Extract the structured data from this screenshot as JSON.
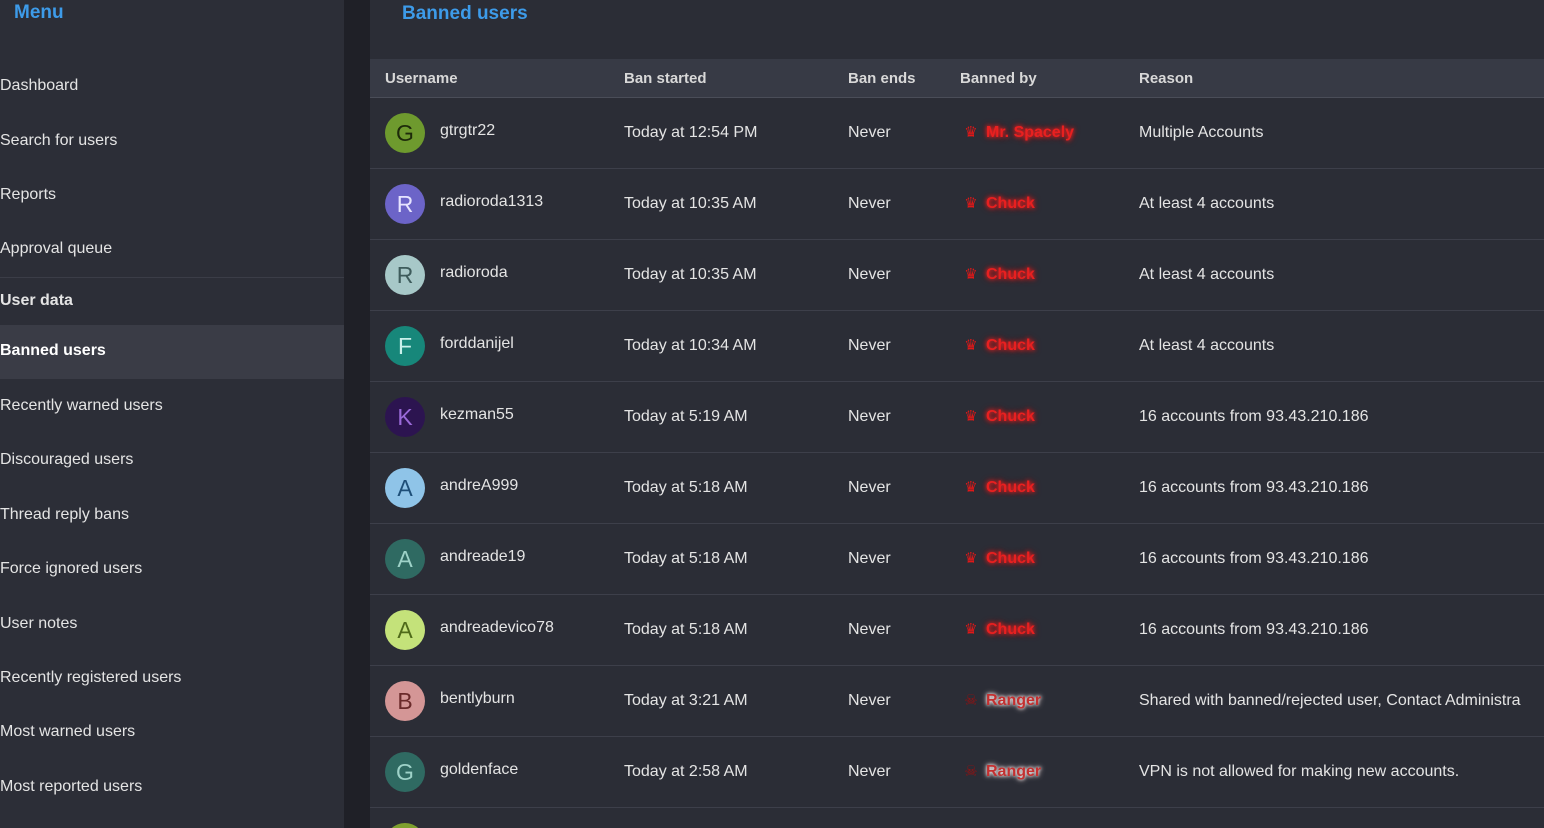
{
  "sidebar": {
    "title": "Menu",
    "items": [
      {
        "label": "Dashboard"
      },
      {
        "label": "Search for users"
      },
      {
        "label": "Reports"
      },
      {
        "label": "Approval queue"
      }
    ],
    "section_label": "User data",
    "active_item": "Banned users",
    "sub_items": [
      {
        "label": "Recently warned users"
      },
      {
        "label": "Discouraged users"
      },
      {
        "label": "Thread reply bans"
      },
      {
        "label": "Force ignored users"
      },
      {
        "label": "User notes"
      },
      {
        "label": "Recently registered users"
      },
      {
        "label": "Most warned users"
      },
      {
        "label": "Most reported users"
      }
    ]
  },
  "main": {
    "title": "Banned users",
    "columns": {
      "username": "Username",
      "ban_started": "Ban started",
      "ban_ends": "Ban ends",
      "banned_by": "Banned by",
      "reason": "Reason"
    },
    "rows": [
      {
        "initial": "G",
        "avatar_bg": "#6e9a2e",
        "avatar_fg": "#1d2a0a",
        "username": "gtrgtr22",
        "ban_started": "Today at 12:54 PM",
        "ban_ends": "Never",
        "banner_icon": "crown-icon",
        "banned_by": "Mr. Spacely",
        "reason": "Multiple Accounts"
      },
      {
        "initial": "R",
        "avatar_bg": "#6c64c8",
        "avatar_fg": "#e6e4ff",
        "username": "radioroda1313",
        "ban_started": "Today at 10:35 AM",
        "ban_ends": "Never",
        "banner_icon": "crown-icon",
        "banned_by": "Chuck",
        "reason": "At least 4 accounts"
      },
      {
        "initial": "R",
        "avatar_bg": "#a7c8c8",
        "avatar_fg": "#3e5c5c",
        "username": "radioroda",
        "ban_started": "Today at 10:35 AM",
        "ban_ends": "Never",
        "banner_icon": "crown-icon",
        "banned_by": "Chuck",
        "reason": "At least 4 accounts"
      },
      {
        "initial": "F",
        "avatar_bg": "#17877a",
        "avatar_fg": "#c8f0ea",
        "username": "forddanijel",
        "ban_started": "Today at 10:34 AM",
        "ban_ends": "Never",
        "banner_icon": "crown-icon",
        "banned_by": "Chuck",
        "reason": "At least 4 accounts"
      },
      {
        "initial": "K",
        "avatar_bg": "#2c1450",
        "avatar_fg": "#9a6ad8",
        "username": "kezman55",
        "ban_started": "Today at 5:19 AM",
        "ban_ends": "Never",
        "banner_icon": "crown-icon",
        "banned_by": "Chuck",
        "reason": "16 accounts from 93.43.210.186"
      },
      {
        "initial": "A",
        "avatar_bg": "#8fc4e8",
        "avatar_fg": "#1e4f78",
        "username": "andreA999",
        "ban_started": "Today at 5:18 AM",
        "ban_ends": "Never",
        "banner_icon": "crown-icon",
        "banned_by": "Chuck",
        "reason": "16 accounts from 93.43.210.186"
      },
      {
        "initial": "A",
        "avatar_bg": "#2f6a62",
        "avatar_fg": "#9ed2c8",
        "username": "andreade19",
        "ban_started": "Today at 5:18 AM",
        "ban_ends": "Never",
        "banner_icon": "crown-icon",
        "banned_by": "Chuck",
        "reason": "16 accounts from 93.43.210.186"
      },
      {
        "initial": "A",
        "avatar_bg": "#c4e27a",
        "avatar_fg": "#4f6a1a",
        "username": "andreadevico78",
        "ban_started": "Today at 5:18 AM",
        "ban_ends": "Never",
        "banner_icon": "crown-icon",
        "banned_by": "Chuck",
        "reason": "16 accounts from 93.43.210.186"
      },
      {
        "initial": "B",
        "avatar_bg": "#d49696",
        "avatar_fg": "#6a2a2a",
        "username": "bentlyburn",
        "ban_started": "Today at 3:21 AM",
        "ban_ends": "Never",
        "banner_icon": "skull-icon",
        "banned_by": "Ranger",
        "reason": "Shared with banned/rejected user, Contact Administra"
      },
      {
        "initial": "G",
        "avatar_bg": "#2f6a62",
        "avatar_fg": "#9ed2c8",
        "username": "goldenface",
        "ban_started": "Today at 2:58 AM",
        "ban_ends": "Never",
        "banner_icon": "skull-icon",
        "banned_by": "Ranger",
        "reason": "VPN is not allowed for making new accounts."
      }
    ],
    "peek_avatar_bg": "#7ea02e"
  }
}
